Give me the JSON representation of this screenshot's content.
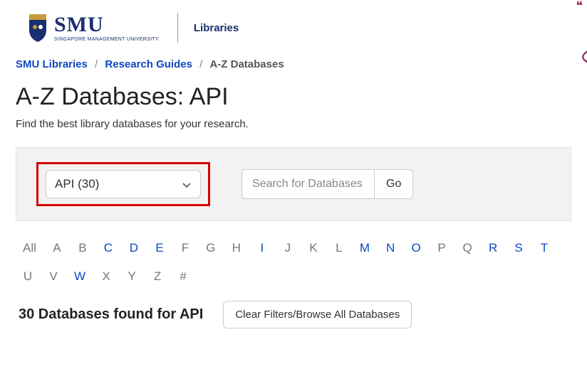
{
  "header": {
    "logo_main": "SMU",
    "logo_sub": "SINGAPORE MANAGEMENT\nUNIVERSITY",
    "libraries_label": "Libraries"
  },
  "breadcrumb": {
    "items": [
      {
        "label": "SMU Libraries",
        "link": true
      },
      {
        "label": "Research Guides",
        "link": true
      },
      {
        "label": "A-Z Databases",
        "link": false
      }
    ],
    "sep": "/"
  },
  "page_title": "A-Z Databases: API",
  "subtitle": "Find the best library databases for your research.",
  "filter": {
    "selected_label": "API (30)"
  },
  "search": {
    "placeholder": "Search for Databases",
    "go_label": "Go"
  },
  "alpha": [
    {
      "label": "All",
      "active": false
    },
    {
      "label": "A",
      "active": false
    },
    {
      "label": "B",
      "active": false
    },
    {
      "label": "C",
      "active": true
    },
    {
      "label": "D",
      "active": true
    },
    {
      "label": "E",
      "active": true
    },
    {
      "label": "F",
      "active": false
    },
    {
      "label": "G",
      "active": false
    },
    {
      "label": "H",
      "active": false
    },
    {
      "label": "I",
      "active": true
    },
    {
      "label": "J",
      "active": false
    },
    {
      "label": "K",
      "active": false
    },
    {
      "label": "L",
      "active": false
    },
    {
      "label": "M",
      "active": true
    },
    {
      "label": "N",
      "active": true
    },
    {
      "label": "O",
      "active": true
    },
    {
      "label": "P",
      "active": false
    },
    {
      "label": "Q",
      "active": false
    },
    {
      "label": "R",
      "active": true
    },
    {
      "label": "S",
      "active": true
    },
    {
      "label": "T",
      "active": true
    },
    {
      "label": "U",
      "active": false
    },
    {
      "label": "V",
      "active": false
    },
    {
      "label": "W",
      "active": true
    },
    {
      "label": "X",
      "active": false
    },
    {
      "label": "Y",
      "active": false
    },
    {
      "label": "Z",
      "active": false
    },
    {
      "label": "#",
      "active": false
    }
  ],
  "results": {
    "count_label": "30 Databases found for API",
    "clear_label": "Clear Filters/Browse All Databases"
  }
}
